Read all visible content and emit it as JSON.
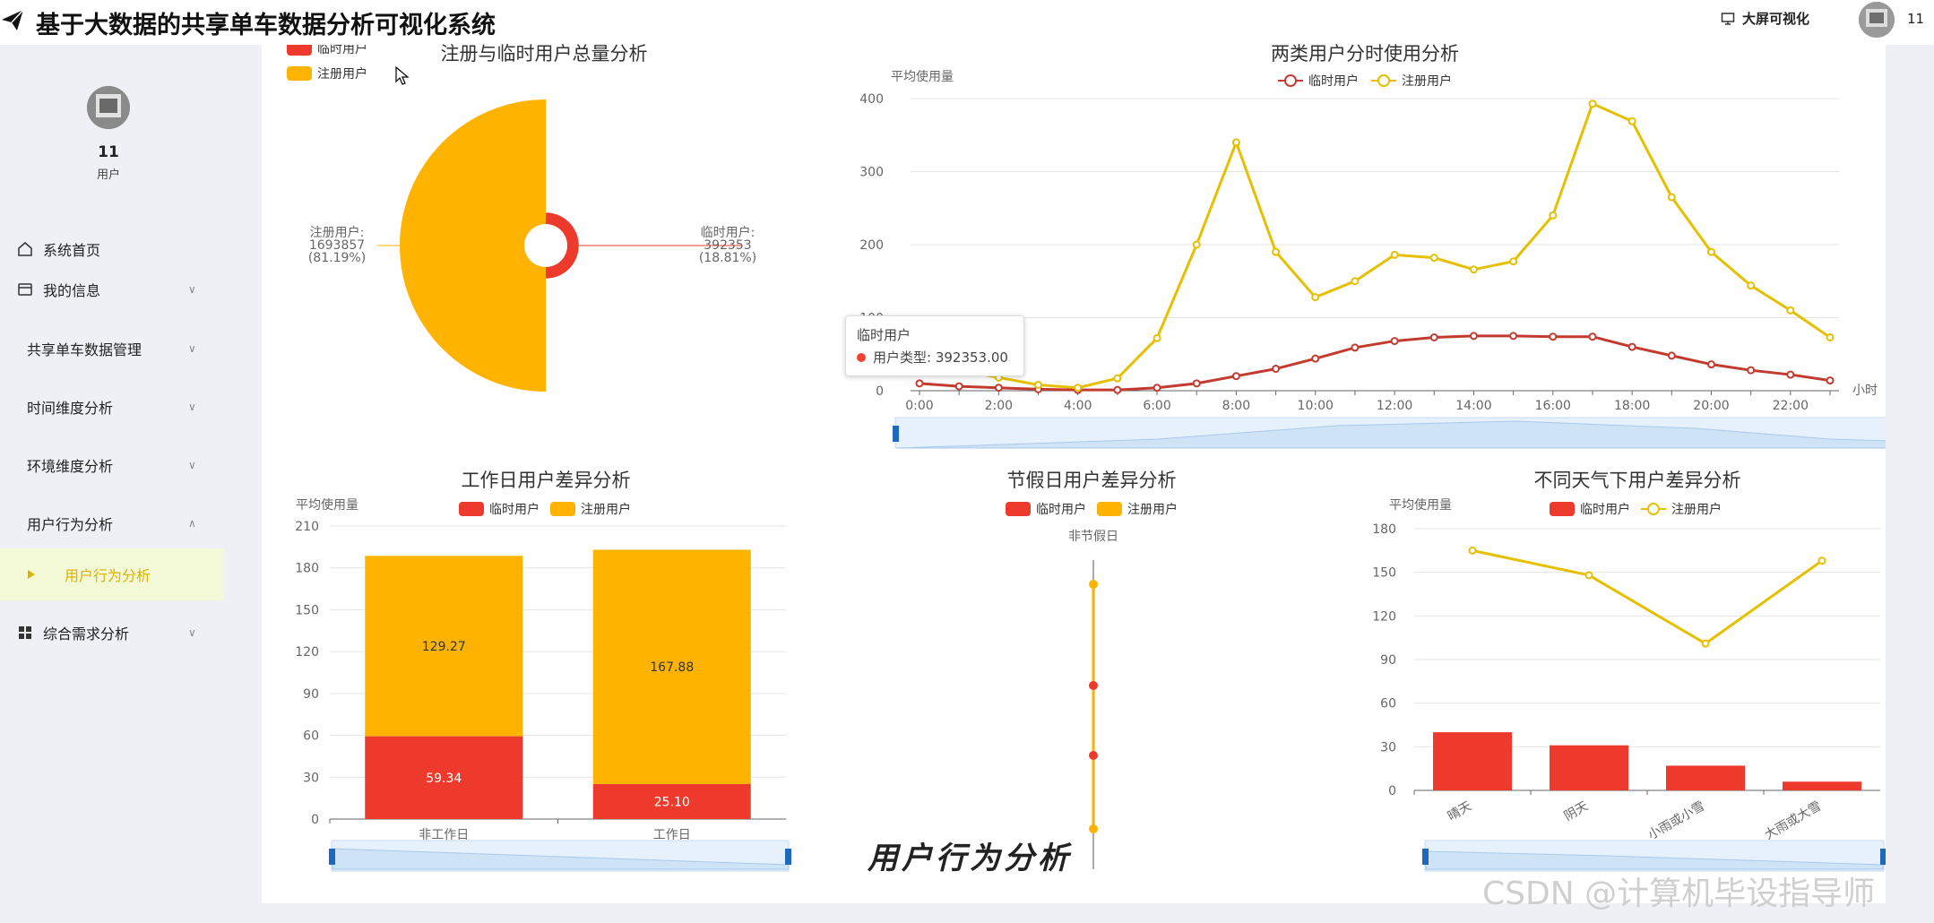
{
  "app": {
    "title": "基于大数据的共享单车数据分析可视化系统",
    "bigscreen_label": "大屏可视化",
    "user_short": "11"
  },
  "sidebar": {
    "user": {
      "name": "11",
      "role": "用户"
    },
    "items": [
      {
        "label": "系统首页",
        "icon": "home-icon",
        "expandable": false
      },
      {
        "label": "我的信息",
        "icon": "wallet-icon",
        "expandable": true
      },
      {
        "label": "共享单车数据管理",
        "icon": "",
        "expandable": true
      },
      {
        "label": "时间维度分析",
        "icon": "",
        "expandable": true
      },
      {
        "label": "环境维度分析",
        "icon": "",
        "expandable": true
      },
      {
        "label": "用户行为分析",
        "icon": "",
        "expandable": true,
        "expanded": true
      },
      {
        "label": "用户行为分析",
        "icon": "play-icon",
        "sub": true,
        "active": true
      },
      {
        "label": "综合需求分析",
        "icon": "grid-icon",
        "expandable": true
      }
    ]
  },
  "colors": {
    "casual": "#ee3a2c",
    "registered": "#fdb300",
    "line_casual": "#c33a2f",
    "line_registered": "#e6c000",
    "accent": "#d9b400"
  },
  "series_names": {
    "casual": "临时用户",
    "registered": "注册用户"
  },
  "tooltip": {
    "title": "临时用户",
    "label": "用户类型: 392353.00"
  },
  "overlay_caption": "用户行为分析",
  "watermark": "CSDN @计算机毕设指导师",
  "chart_data": [
    {
      "type": "pie",
      "subtype": "rose",
      "title": "注册与临时用户总量分析",
      "legend": [
        "临时用户",
        "注册用户"
      ],
      "legend_position": "top-left",
      "slices": [
        {
          "name": "临时用户",
          "value": 392353,
          "percent": "18.81%",
          "label_line1": "临时用户:",
          "label_line2": "392353",
          "label_line3": "(18.81%)"
        },
        {
          "name": "注册用户",
          "value": 1693857,
          "percent": "81.19%",
          "label_line1": "注册用户:",
          "label_line2": "1693857",
          "label_line3": "(81.19%)"
        }
      ]
    },
    {
      "type": "line",
      "title": "两类用户分时使用分析",
      "ylabel": "平均使用量",
      "xlabel": "小时",
      "ylim": [
        0,
        400
      ],
      "yticks": [
        "0",
        "100",
        "200",
        "300",
        "400"
      ],
      "x": [
        "0:00",
        "1:00",
        "2:00",
        "3:00",
        "4:00",
        "5:00",
        "6:00",
        "7:00",
        "8:00",
        "9:00",
        "10:00",
        "11:00",
        "12:00",
        "13:00",
        "14:00",
        "15:00",
        "16:00",
        "17:00",
        "18:00",
        "19:00",
        "20:00",
        "21:00",
        "22:00",
        "23:00"
      ],
      "xticks": [
        "0:00",
        "2:00",
        "4:00",
        "6:00",
        "8:00",
        "10:00",
        "12:00",
        "14:00",
        "16:00",
        "18:00",
        "20:00",
        "22:00"
      ],
      "legend_position": "top-center",
      "series": [
        {
          "name": "临时用户",
          "values": [
            10,
            6,
            4,
            2,
            1,
            1,
            4,
            10,
            20,
            30,
            44,
            59,
            68,
            73,
            75,
            75,
            74,
            74,
            60,
            48,
            36,
            28,
            22,
            14
          ]
        },
        {
          "name": "注册用户",
          "values": [
            44,
            28,
            18,
            8,
            4,
            17,
            72,
            200,
            340,
            190,
            128,
            150,
            186,
            182,
            166,
            177,
            240,
            393,
            369,
            265,
            190,
            144,
            110,
            73
          ]
        }
      ],
      "dataZoom": true
    },
    {
      "type": "bar",
      "stacked": true,
      "title": "工作日用户差异分析",
      "ylabel": "平均使用量",
      "categories": [
        "非工作日",
        "工作日"
      ],
      "ylim": [
        0,
        210
      ],
      "yticks": [
        "0",
        "30",
        "60",
        "90",
        "120",
        "150",
        "180",
        "210"
      ],
      "series": [
        {
          "name": "临时用户",
          "values": [
            59.34,
            25.1
          ],
          "labels": [
            "59.34",
            "25.10"
          ]
        },
        {
          "name": "注册用户",
          "values": [
            129.27,
            167.88
          ],
          "labels": [
            "129.27",
            "167.88"
          ]
        }
      ],
      "legend_position": "top-center",
      "dataZoom": true
    },
    {
      "type": "scatter",
      "title": "节假日用户差异分析",
      "axis_label": "非节假日",
      "legend": [
        "临时用户",
        "注册用户"
      ],
      "legend_position": "top-center"
    },
    {
      "type": "bar",
      "title": "不同天气下用户差异分析",
      "ylabel": "平均使用量",
      "categories": [
        "晴天",
        "阴天",
        "小雨或小雪",
        "大雨或大雪"
      ],
      "ylim": [
        0,
        180
      ],
      "yticks": [
        "0",
        "30",
        "60",
        "90",
        "120",
        "150",
        "180"
      ],
      "series": [
        {
          "name": "临时用户",
          "type": "bar",
          "values": [
            40,
            31,
            17,
            6
          ]
        },
        {
          "name": "注册用户",
          "type": "line",
          "values": [
            165,
            148,
            101,
            158
          ]
        }
      ],
      "legend_position": "top-center",
      "dataZoom": true
    }
  ]
}
